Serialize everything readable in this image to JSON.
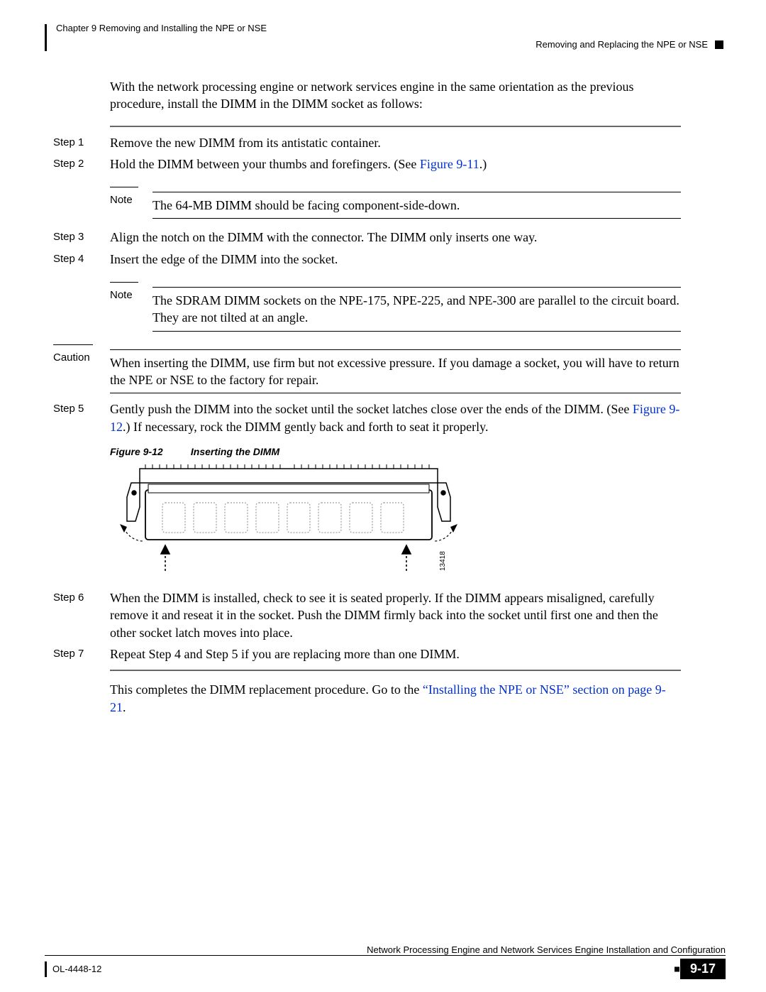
{
  "header": {
    "chapter_line": "Chapter 9    Removing and Installing the NPE or NSE",
    "section_title": "Removing and Replacing the NPE or NSE"
  },
  "intro": "With the network processing engine or network services engine in the same orientation as the previous procedure, install the DIMM in the DIMM socket as follows:",
  "steps": {
    "s1": {
      "label": "Step 1",
      "text": "Remove the new DIMM from its antistatic container."
    },
    "s2": {
      "label": "Step 2",
      "text_before": "Hold the DIMM between your thumbs and forefingers. (See ",
      "link": "Figure 9-11",
      "text_after": ".)"
    },
    "s3": {
      "label": "Step 3",
      "text": "Align the notch on the DIMM with the connector. The DIMM only inserts one way."
    },
    "s4": {
      "label": "Step 4",
      "text": "Insert the edge of the DIMM into the socket."
    },
    "s5": {
      "label": "Step 5",
      "text_before": "Gently push the DIMM into the socket until the socket latches close over the ends of the DIMM. (See ",
      "link": "Figure 9-12",
      "text_after": ".) If necessary, rock the DIMM gently back and forth to seat it properly."
    },
    "s6": {
      "label": "Step 6",
      "text": "When the DIMM is installed, check to see it is seated properly. If the DIMM appears misaligned, carefully remove it and reseat it in the socket. Push the DIMM firmly back into the socket until first one and then the other socket latch moves into place."
    },
    "s7": {
      "label": "Step 7",
      "text": "Repeat Step 4 and Step 5 if you are replacing more than one DIMM."
    }
  },
  "notes": {
    "n1": {
      "label": "Note",
      "text": "The 64-MB DIMM should be facing component-side-down."
    },
    "n2": {
      "label": "Note",
      "text": "The SDRAM DIMM sockets on the NPE-175, NPE-225, and NPE-300 are parallel to the circuit board. They are not tilted at an angle."
    }
  },
  "caution": {
    "label": "Caution",
    "text": "When inserting the DIMM, use firm but not excessive pressure. If you damage a socket, you will have to return the NPE or NSE to the factory for repair."
  },
  "figure": {
    "number": "Figure 9-12",
    "title": "Inserting the DIMM",
    "drawing_id": "13418"
  },
  "closing": {
    "text_before": "This completes the DIMM replacement procedure. Go to the ",
    "link": "“Installing the NPE or NSE” section on page 9-21",
    "text_after": "."
  },
  "footer": {
    "doc_title": "Network Processing Engine and Network Services Engine Installation and Configuration",
    "doc_number": "OL-4448-12",
    "page_number": "9-17"
  }
}
